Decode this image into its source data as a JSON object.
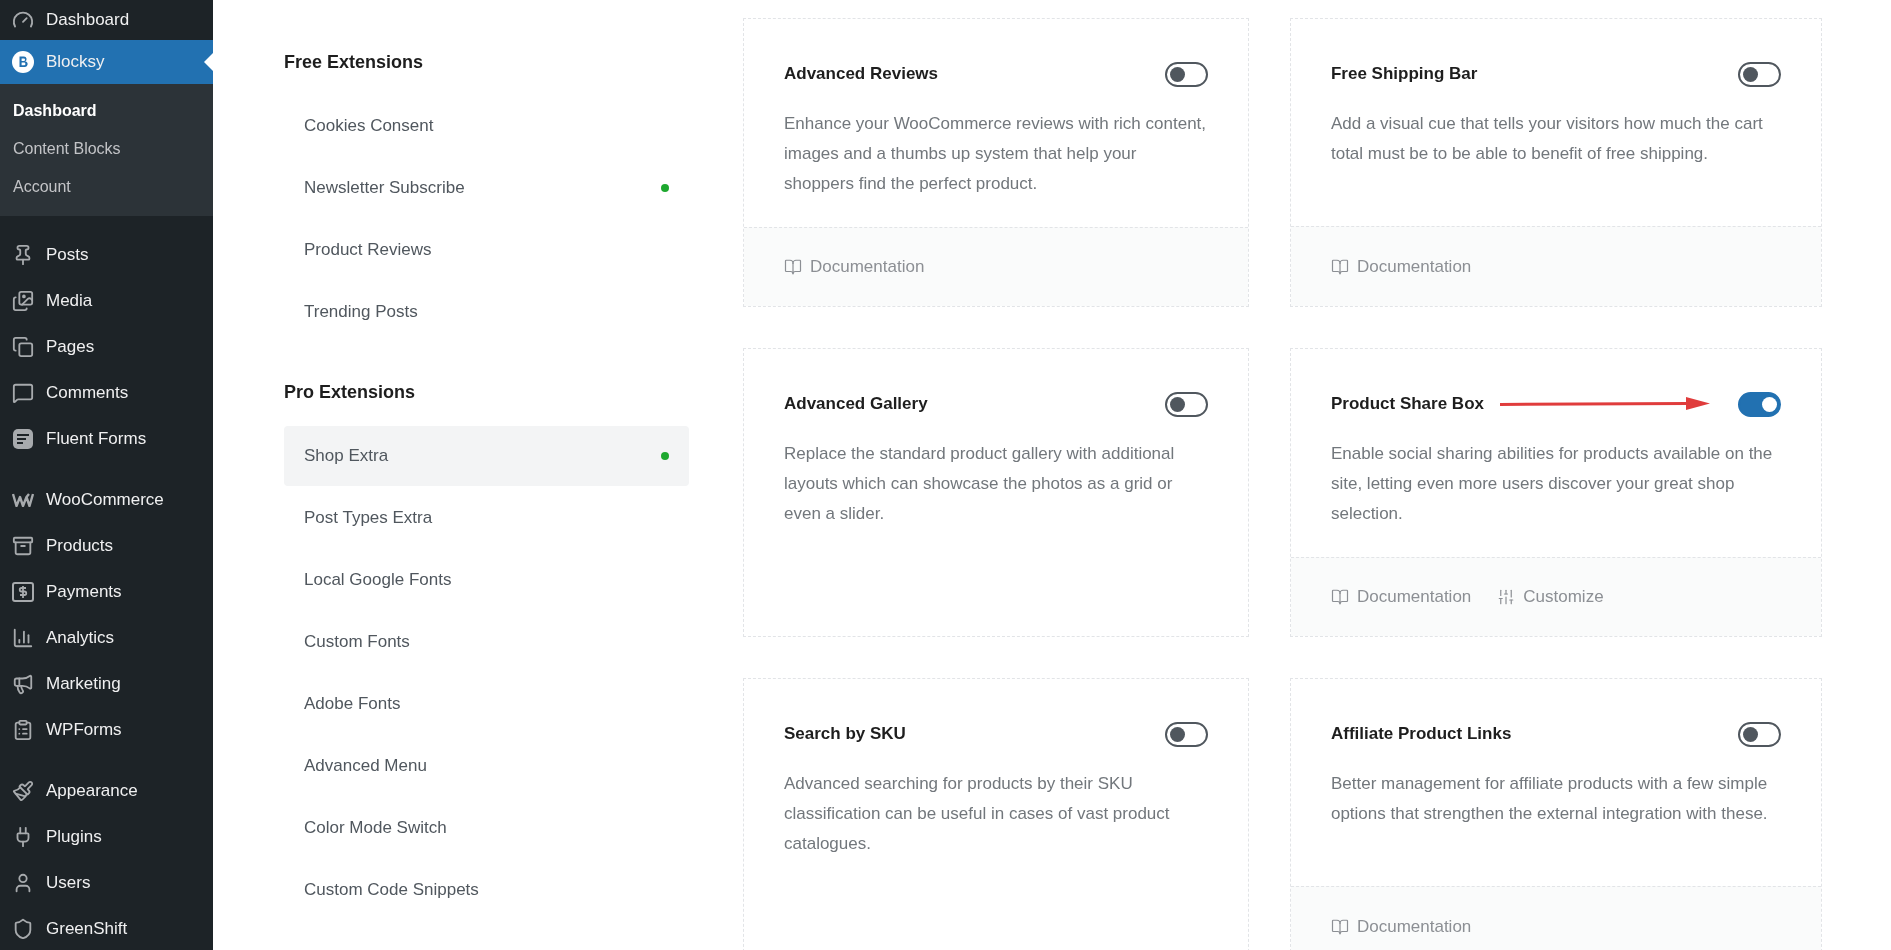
{
  "sidebar": {
    "top_items": [
      {
        "label": "Dashboard",
        "selected": false
      },
      {
        "label": "Blocksy",
        "selected": true,
        "children": [
          {
            "label": "Dashboard",
            "selected": true
          },
          {
            "label": "Content Blocks",
            "selected": false
          },
          {
            "label": "Account",
            "selected": false
          }
        ]
      }
    ],
    "groups": [
      [
        {
          "label": "Posts",
          "selected": false
        },
        {
          "label": "Media",
          "selected": false
        },
        {
          "label": "Pages",
          "selected": false
        },
        {
          "label": "Comments",
          "selected": false
        },
        {
          "label": "Fluent Forms",
          "selected": false
        }
      ],
      [
        {
          "label": "WooCommerce",
          "selected": false
        },
        {
          "label": "Products",
          "selected": false
        },
        {
          "label": "Payments",
          "selected": false
        },
        {
          "label": "Analytics",
          "selected": false
        },
        {
          "label": "Marketing",
          "selected": false
        },
        {
          "label": "WPForms",
          "selected": false
        }
      ],
      [
        {
          "label": "Appearance",
          "selected": false
        },
        {
          "label": "Plugins",
          "selected": false
        },
        {
          "label": "Users",
          "selected": false
        },
        {
          "label": "GreenShift",
          "selected": false
        }
      ]
    ]
  },
  "extension_nav": [
    {
      "heading": "Free Extensions",
      "items": [
        {
          "label": "Cookies Consent",
          "selected": false,
          "enabled": false
        },
        {
          "label": "Newsletter Subscribe",
          "selected": false,
          "enabled": true
        },
        {
          "label": "Product Reviews",
          "selected": false,
          "enabled": false
        },
        {
          "label": "Trending Posts",
          "selected": false,
          "enabled": false
        }
      ]
    },
    {
      "heading": "Pro Extensions",
      "items": [
        {
          "label": "Shop Extra",
          "selected": true,
          "enabled": true
        },
        {
          "label": "Post Types Extra",
          "selected": false,
          "enabled": false
        },
        {
          "label": "Local Google Fonts",
          "selected": false,
          "enabled": false
        },
        {
          "label": "Custom Fonts",
          "selected": false,
          "enabled": false
        },
        {
          "label": "Adobe Fonts",
          "selected": false,
          "enabled": false
        },
        {
          "label": "Advanced Menu",
          "selected": false,
          "enabled": false
        },
        {
          "label": "Color Mode Switch",
          "selected": false,
          "enabled": false
        },
        {
          "label": "Custom Code Snippets",
          "selected": false,
          "enabled": false
        }
      ]
    }
  ],
  "cards": [
    {
      "title": "Advanced Reviews",
      "on": false,
      "arrow": false,
      "description": "Enhance your WooCommerce reviews with rich content, images and a thumbs up system that help your shoppers find the perfect product.",
      "links": [
        {
          "label": "Documentation",
          "kind": "docs"
        }
      ]
    },
    {
      "title": "Free Shipping Bar",
      "on": false,
      "arrow": false,
      "description": "Add a visual cue that tells your visitors how much the cart total must be to be able to benefit of free shipping.",
      "links": [
        {
          "label": "Documentation",
          "kind": "docs"
        }
      ]
    },
    {
      "title": "Advanced Gallery",
      "on": false,
      "arrow": false,
      "description": "Replace the standard product gallery with additional layouts which can showcase the photos as a grid or even a slider."
    },
    {
      "title": "Product Share Box",
      "on": true,
      "arrow": true,
      "description": "Enable social sharing abilities for products available on the site, letting even more users discover your great shop selection.",
      "links": [
        {
          "label": "Documentation",
          "kind": "docs"
        },
        {
          "label": "Customize",
          "kind": "customize"
        }
      ]
    },
    {
      "title": "Search by SKU",
      "on": false,
      "arrow": false,
      "description": "Advanced searching for products by their SKU classification can be useful in cases of vast product catalogues."
    },
    {
      "title": "Affiliate Product Links",
      "on": false,
      "arrow": false,
      "description": "Better management for affiliate products with a few simple options that strengthen the external integration with these.",
      "links": [
        {
          "label": "Documentation",
          "kind": "docs"
        }
      ]
    }
  ]
}
